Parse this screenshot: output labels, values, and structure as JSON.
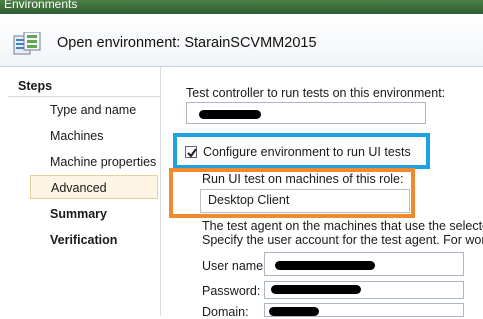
{
  "window": {
    "title": "Environments"
  },
  "header": {
    "title": "Open environment: StarainSCVMM2015",
    "icon": "environment-wizard-icon"
  },
  "steps": {
    "title": "Steps",
    "items": [
      {
        "label": "Type and name",
        "bold": false,
        "selected": false
      },
      {
        "label": "Machines",
        "bold": false,
        "selected": false
      },
      {
        "label": "Machine properties",
        "bold": false,
        "selected": false
      },
      {
        "label": "Advanced",
        "bold": false,
        "selected": true
      },
      {
        "label": "Summary",
        "bold": true,
        "selected": false
      },
      {
        "label": "Verification",
        "bold": true,
        "selected": false
      }
    ]
  },
  "main": {
    "controller_label": "Test controller to run tests on this environment:",
    "configure_ui_label": "Configure environment to run UI tests",
    "configure_ui_checked": true,
    "role_label": "Run UI test on machines of this role:",
    "role_value": "Desktop Client",
    "agent_text_1": "The test agent on the machines that use the selected",
    "agent_text_2": "Specify the user account for the test agent. For workg",
    "username_label": "User name:",
    "password_label": "Password:",
    "domain_label": "Domain:"
  },
  "colors": {
    "highlight_blue": "#1da1e0",
    "highlight_orange": "#f08a2c",
    "titlebar": "#3c6b3d",
    "selected_step": "#fdf4e3"
  }
}
